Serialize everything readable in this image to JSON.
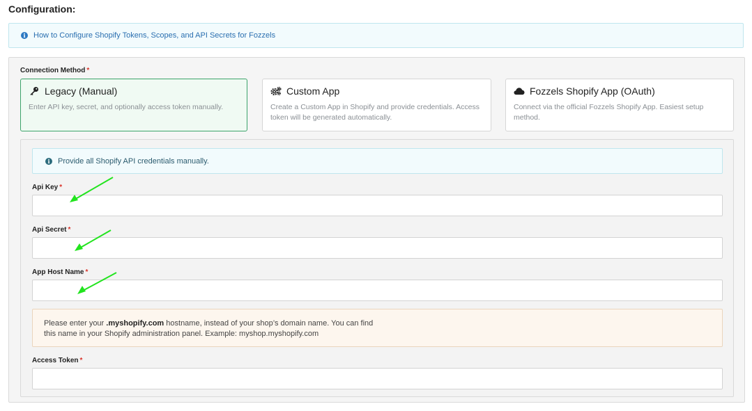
{
  "page": {
    "title": "Configuration:"
  },
  "info_banner": {
    "icon": "info-icon",
    "text": "How to Configure Shopify Tokens, Scopes, and API Secrets for Fozzels"
  },
  "connection_method": {
    "label": "Connection Method",
    "required_mark": "*",
    "options": [
      {
        "title": "Legacy (Manual)",
        "icon": "key-icon",
        "description": "Enter API key, secret, and optionally access token manually.",
        "selected": true
      },
      {
        "title": "Custom App",
        "icon": "gears-icon",
        "description": "Create a Custom App in Shopify and provide credentials. Access token will be generated automatically.",
        "selected": false
      },
      {
        "title": "Fozzels Shopify App (OAuth)",
        "icon": "cloud-icon",
        "description": "Connect via the official Fozzels Shopify App. Easiest setup method.",
        "selected": false
      }
    ]
  },
  "legacy": {
    "info_text": "Provide all Shopify API credentials manually.",
    "fields": [
      {
        "label": "Api Key",
        "required_mark": "*",
        "value": ""
      },
      {
        "label": "Api Secret",
        "required_mark": "*",
        "value": ""
      },
      {
        "label": "App Host Name",
        "required_mark": "*",
        "value": ""
      },
      {
        "label": "Access Token",
        "required_mark": "*",
        "value": ""
      }
    ],
    "hostname_notice": {
      "prefix": "Please enter your ",
      "emphasis": ".myshopify.com",
      "suffix": " hostname, instead of your shop’s domain name. You can find",
      "line2": "this name in your Shopify administration panel. Example: myshop.myshopify.com"
    }
  },
  "colors": {
    "accent_green": "#3ba36a",
    "info_blue": "#2b78c2",
    "required_red": "#d9342b",
    "annotation_arrow": "#22e41e"
  }
}
